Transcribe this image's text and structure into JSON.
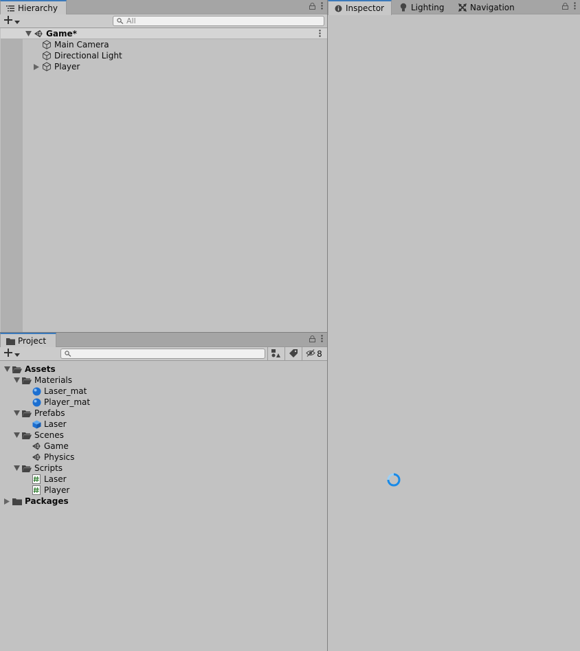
{
  "hierarchy": {
    "tab_label": "Hierarchy",
    "search_placeholder": "All",
    "scene_name": "Game*",
    "items": [
      {
        "label": "Main Camera",
        "icon": "gameobject-icon"
      },
      {
        "label": "Directional Light",
        "icon": "gameobject-icon"
      },
      {
        "label": "Player",
        "icon": "gameobject-icon",
        "collapsed": true
      }
    ]
  },
  "project": {
    "tab_label": "Project",
    "search_placeholder": "",
    "hidden_count": "8",
    "tree": {
      "assets": "Assets",
      "materials": "Materials",
      "laser_mat": "Laser_mat",
      "player_mat": "Player_mat",
      "prefabs": "Prefabs",
      "laser_prefab": "Laser",
      "scenes": "Scenes",
      "game_scene": "Game",
      "physics_scene": "Physics",
      "scripts": "Scripts",
      "laser_script": "Laser",
      "player_script": "Player",
      "packages": "Packages"
    }
  },
  "inspector": {
    "tabs": [
      "Inspector",
      "Lighting",
      "Navigation"
    ],
    "active_tab": "Inspector"
  },
  "colors": {
    "panel_bg": "#c2c2c2",
    "tab_active_accent": "#3a79bb",
    "material_blue": "#1c6fd1",
    "script_green": "#2a7a2a"
  }
}
